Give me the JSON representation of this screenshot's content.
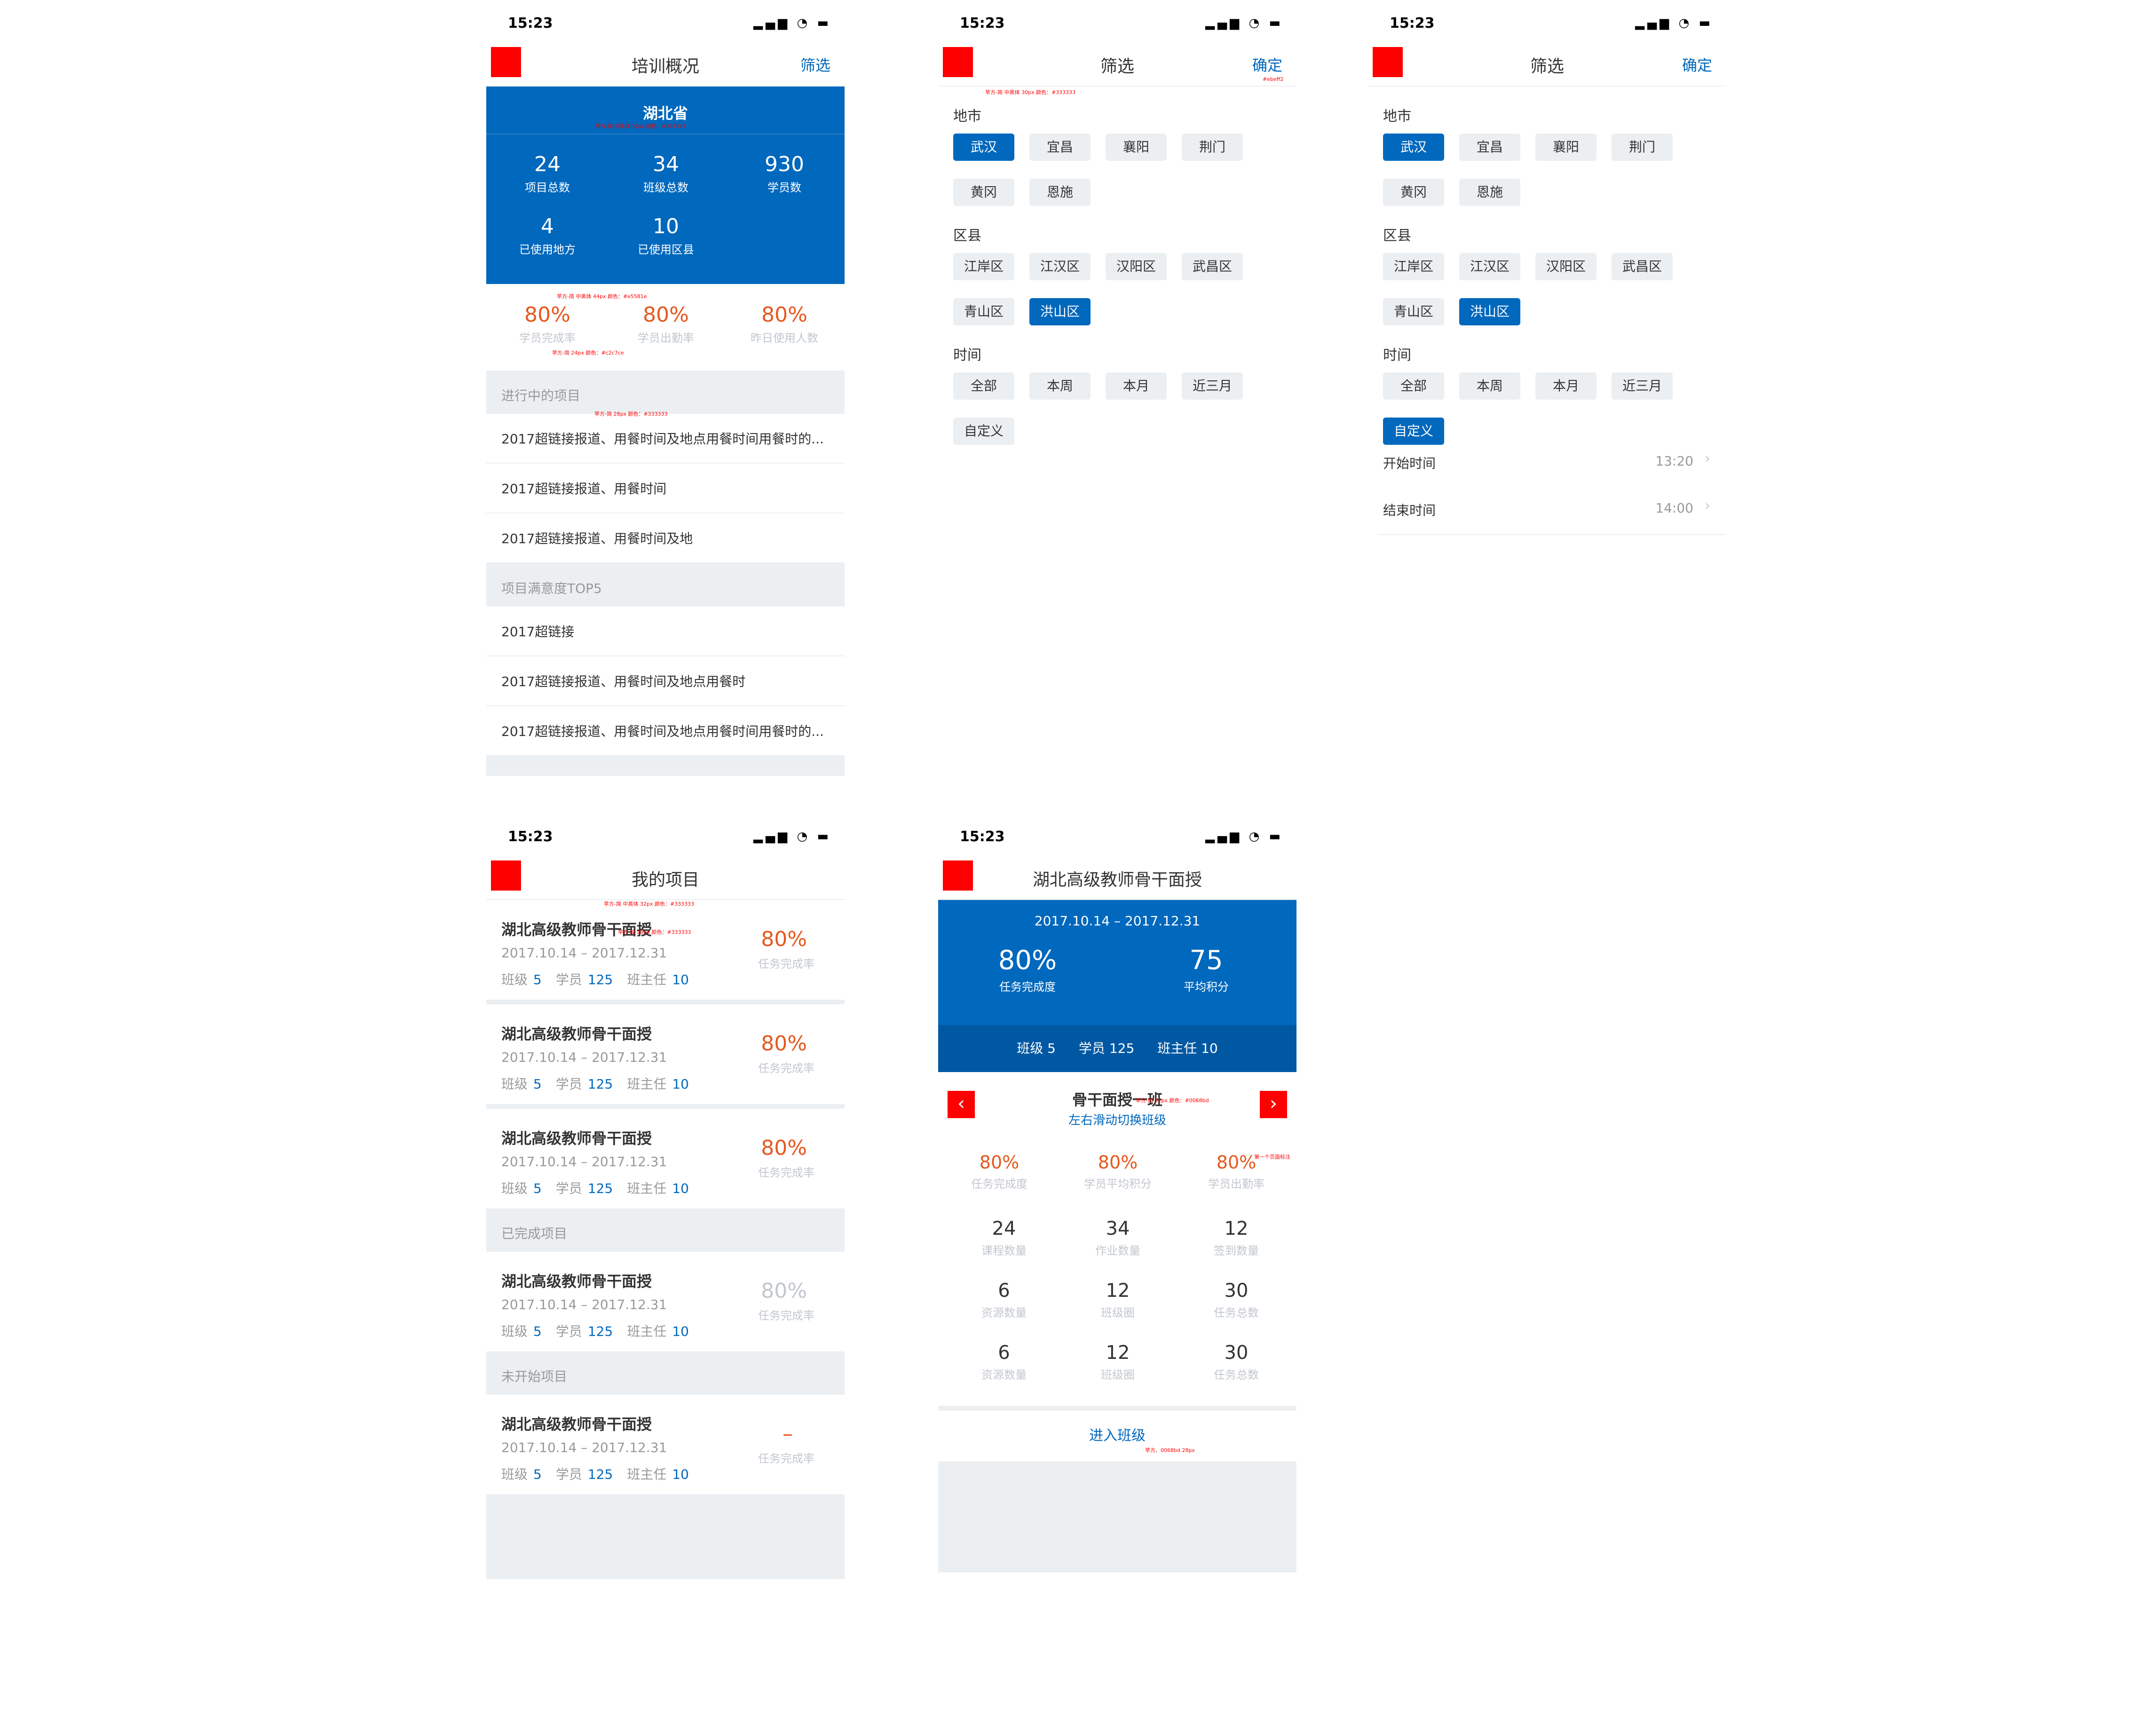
{
  "status": {
    "time": "15:23",
    "icons": "▂▄▆ ◔ ▬"
  },
  "colors": {
    "brand": "#0068bd",
    "accent": "#e5581e",
    "bg_gray": "#ebeff2",
    "muted": "#c2c7ce",
    "back": "#ff0000"
  },
  "s1": {
    "title": "培训概况",
    "action": "筛选",
    "province": "湖北省",
    "stats": [
      {
        "value": "24",
        "label": "项目总数"
      },
      {
        "value": "34",
        "label": "班级总数"
      },
      {
        "value": "930",
        "label": "学员数"
      },
      {
        "value": "4",
        "label": "已使用地方"
      },
      {
        "value": "10",
        "label": "已使用区县"
      }
    ],
    "rates": [
      {
        "value": "80%",
        "label": "学员完成率"
      },
      {
        "value": "80%",
        "label": "学员出勤率"
      },
      {
        "value": "80%",
        "label": "昨日使用人数"
      }
    ],
    "section1": "进行中的项目",
    "ongoing": [
      "2017超链接报道、用餐时间及地点用餐时间用餐时的...",
      "2017超链接报道、用餐时间",
      "2017超链接报道、用餐时间及地"
    ],
    "section2": "项目满意度TOP5",
    "top5": [
      "2017超链接",
      "2017超链接报道、用餐时间及地点用餐时",
      "2017超链接报道、用餐时间及地点用餐时间用餐时的..."
    ]
  },
  "filter": {
    "title": "筛选",
    "action": "确定",
    "city_label": "地市",
    "cities": [
      "武汉",
      "宜昌",
      "襄阳",
      "荆门",
      "黄冈",
      "恩施"
    ],
    "district_label": "区县",
    "districts": [
      "江岸区",
      "江汉区",
      "汉阳区",
      "武昌区",
      "青山区",
      "洪山区"
    ],
    "time_label": "时间",
    "times": [
      "全部",
      "本周",
      "本月",
      "近三月",
      "自定义"
    ],
    "start_label": "开始时间",
    "start_value": "13:20",
    "end_label": "结束时间",
    "end_value": "14:00"
  },
  "s4": {
    "title": "我的项目",
    "project_name": "湖北高级教师骨干面授",
    "dates": "2017.10.14 – 2017.12.31",
    "class_label": "班级",
    "class_val": "5",
    "student_label": "学员",
    "student_val": "125",
    "head_label": "班主任",
    "head_val": "10",
    "pct": "80%",
    "pct_label": "任务完成率",
    "dash": "–",
    "done_section": "已完成项目",
    "notstarted_section": "未开始项目"
  },
  "s5": {
    "title": "湖北高级教师骨干面授",
    "dates": "2017.10.14 – 2017.12.31",
    "big1": "80%",
    "big1_label": "任务完成度",
    "big2": "75",
    "big2_label": "平均积分",
    "class_label": "班级",
    "class_val": "5",
    "student_label": "学员",
    "student_val": "125",
    "head_label": "班主任",
    "head_val": "10",
    "class_name": "骨干面授一班",
    "swipe_hint": "左右滑动切换班级",
    "rates": [
      {
        "value": "80%",
        "label": "任务完成度"
      },
      {
        "value": "80%",
        "label": "学员平均积分"
      },
      {
        "value": "80%",
        "label": "学员出勤率"
      }
    ],
    "grid": [
      {
        "value": "24",
        "label": "课程数量"
      },
      {
        "value": "34",
        "label": "作业数量"
      },
      {
        "value": "12",
        "label": "签到数量"
      },
      {
        "value": "6",
        "label": "资源数量"
      },
      {
        "value": "12",
        "label": "班级圈"
      },
      {
        "value": "30",
        "label": "任务总数"
      },
      {
        "value": "6",
        "label": "资源数量"
      },
      {
        "value": "12",
        "label": "班级圈"
      },
      {
        "value": "30",
        "label": "任务总数"
      }
    ],
    "enter": "进入班级"
  },
  "annotations": {
    "a1": "苹方-简 中黑体 30px 颜色：#333333",
    "a2": "苹方-简 中黑体 44px 颜色：#e5581e",
    "a3": "苹方-简 28px 颜色：#333333",
    "a4": "苹方-简 24px 颜色：#c2c7ce",
    "a5": "苹方-简 32px 颜色：#0068bd",
    "a6": "苹方-简 中黑体 32px 颜色：#333333",
    "a7": "#ebeff2",
    "a8": "苹方、0068bd 28px",
    "a9": "第一个页面标注"
  }
}
